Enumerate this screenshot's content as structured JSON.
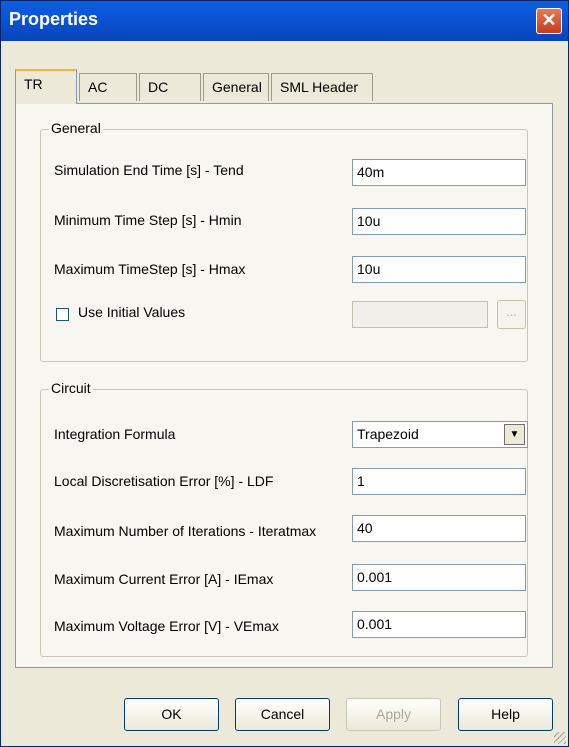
{
  "window": {
    "title": "Properties"
  },
  "tabs": [
    {
      "label": "TR"
    },
    {
      "label": "AC"
    },
    {
      "label": "DC"
    },
    {
      "label": "General"
    },
    {
      "label": "SML Header"
    }
  ],
  "general": {
    "legend": "General",
    "end_time_label": "Simulation End Time [s] - Tend",
    "end_time_value": "40m",
    "min_step_label": "Minimum Time Step [s] - Hmin",
    "min_step_value": "10u",
    "max_step_label": "Maximum TimeStep [s] - Hmax",
    "max_step_value": "10u",
    "use_initial_label": "Use Initial Values",
    "use_initial_checked": false,
    "initial_values_value": "",
    "browse_label": "..."
  },
  "circuit": {
    "legend": "Circuit",
    "integration_label": "Integration Formula",
    "integration_value": "Trapezoid",
    "ldf_label": "Local Discretisation Error [%] - LDF",
    "ldf_value": "1",
    "iter_label": "Maximum Number of Iterations - Iteratmax",
    "iter_value": "40",
    "current_label": "Maximum Current Error [A] - IEmax",
    "current_value": "0.001",
    "voltage_label": "Maximum Voltage Error [V] - VEmax",
    "voltage_value": "0.001"
  },
  "buttons": {
    "ok": "OK",
    "cancel": "Cancel",
    "apply": "Apply",
    "help": "Help"
  },
  "icons": {
    "close": "close-icon",
    "dropdown": "chevron-down-icon"
  }
}
